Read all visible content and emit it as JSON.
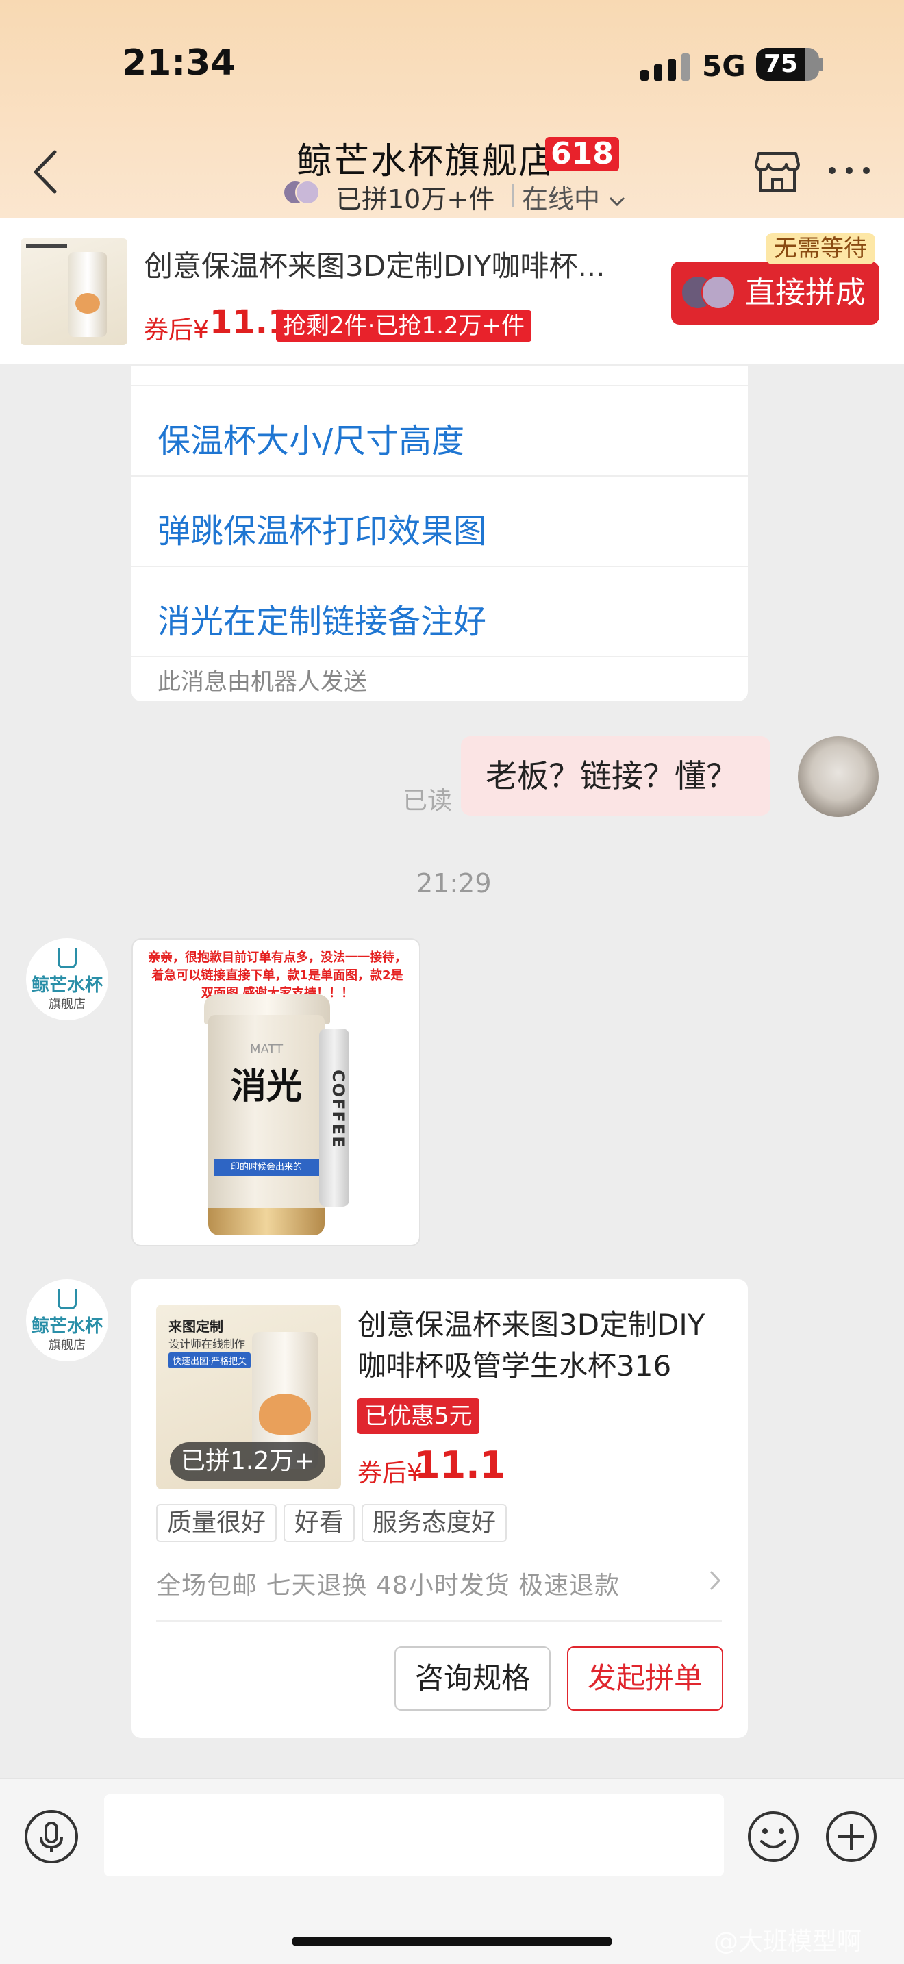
{
  "status_bar": {
    "time": "21:34",
    "network": "5G",
    "battery": "75"
  },
  "header": {
    "shop_name": "鲸芒水杯旗舰店",
    "badge": "618",
    "sold_text": "已拼10万+件",
    "online_status": "在线中"
  },
  "banner": {
    "title": "创意保温杯来图3D定制DIY咖啡杯...",
    "price_label": "券后¥",
    "price": "11.1",
    "sale_tag": "抢剩2件·已抢1.2万+件",
    "no_wait": "无需等待",
    "direct_button": "直接拼成"
  },
  "robot_card": {
    "links": [
      "保温杯大小/尺寸高度",
      "弹跳保温杯打印效果图",
      "消光在定制链接备注好"
    ],
    "note": "此消息由机器人发送"
  },
  "outgoing": {
    "read_label": "已读",
    "text": "老板？链接？懂？"
  },
  "timestamp": "21:29",
  "shop_avatar": {
    "name": "鲸芒水杯",
    "sub": "旗舰店"
  },
  "image_message": {
    "note": "亲亲，很抱歉目前订单有点多，没法一一接待，着急可以链接直接下单，款1是单面图，款2是双面图 感谢大家支持！！！",
    "brand": "MATT",
    "big_text": "消光",
    "band_text": "印的时候会出来的",
    "strap_text": "COFFEE"
  },
  "product_card": {
    "thumb_title": "来图定制",
    "thumb_sub": "设计师在线制作",
    "thumb_tag": "快速出图·严格把关",
    "sold": "已拼1.2万+",
    "title": "创意保温杯来图3D定制DIY咖啡杯吸管学生水杯316",
    "discount": "已优惠5元",
    "price_label": "券后¥",
    "price": "11.1",
    "tags": [
      "质量很好",
      "好看",
      "服务态度好"
    ],
    "services": "全场包邮  七天退换  48小时发货  极速退款",
    "btn_consult": "咨询规格",
    "btn_group": "发起拼单"
  },
  "input": {
    "placeholder": ""
  },
  "watermark": "@大班模型啊"
}
